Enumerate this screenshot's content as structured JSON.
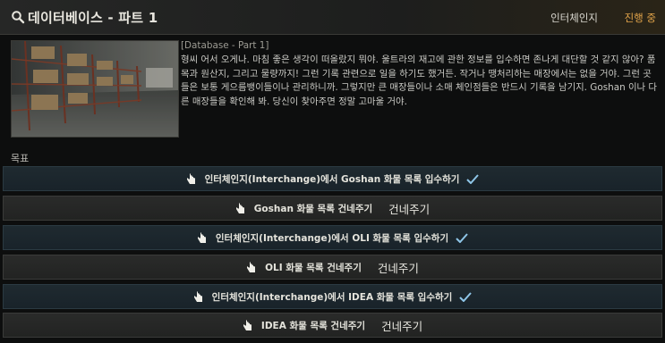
{
  "header": {
    "title": "데이터베이스 - 파트 1",
    "trader": "인터체인지",
    "status": "진행 중"
  },
  "description": {
    "tag": "[Database - Part 1]",
    "text": "형씨 어서 오게나. 마침 좋은 생각이 떠올랐지 뭐야. 울트라의 재고에 관한 정보를 입수하면 존나게 대단할 것 같지 않아? 품목과 원산지, 그리고 물량까지! 그런 기록 관련으로 일을 하기도 했거든. 작거나 땡처리하는 매장에서는 없을 거야. 그런 곳들은 보통 게으름뱅이들이나 관리하니까. 그렇지만 큰 매장들이나 소매 체인점들은 반드시 기록을 남기지. Goshan 이나 다른 매장들을 확인해 봐. 당신이 찾아주면 정말 고마울 거야."
  },
  "objectives_label": "목표",
  "objectives": [
    {
      "type": "quest",
      "text": "인터체인지(Interchange)에서 Goshan 화물 목록 입수하기",
      "done": true
    },
    {
      "type": "handover",
      "text": "Goshan 화물 목록 건네주기",
      "button": "건네주기"
    },
    {
      "type": "quest",
      "text": "인터체인지(Interchange)에서 OLI 화물 목록 입수하기",
      "done": true
    },
    {
      "type": "handover",
      "text": "OLI 화물 목록 건네주기",
      "button": "건네주기"
    },
    {
      "type": "quest",
      "text": "인터체인지(Interchange)에서 IDEA 화물 목록 입수하기",
      "done": true
    },
    {
      "type": "handover",
      "text": "IDEA 화물 목록 건네주기",
      "button": "건네주기"
    }
  ],
  "colors": {
    "accent": "#e2a44a",
    "check": "#8fc6e8"
  },
  "icons": [
    "search-icon",
    "hand-pointer-icon",
    "checkmark-icon"
  ]
}
